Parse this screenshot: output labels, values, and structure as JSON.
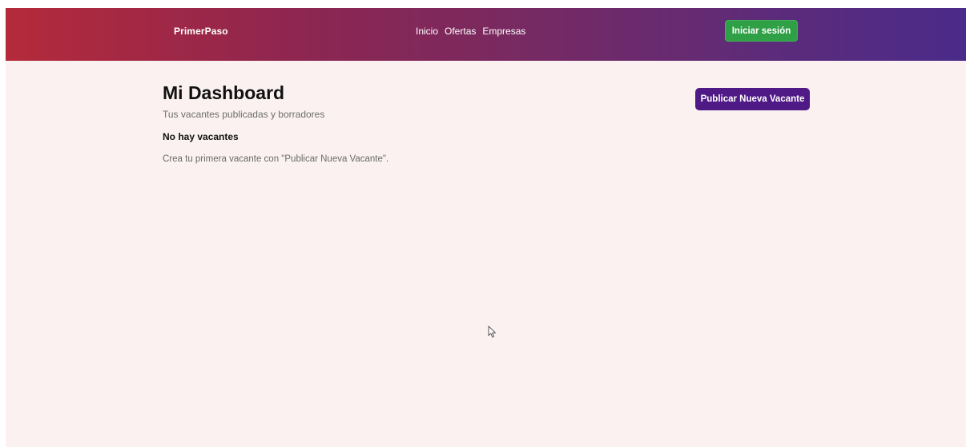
{
  "header": {
    "brand": "PrimerPaso",
    "nav": [
      "Inicio",
      "Ofertas",
      "Empresas"
    ],
    "login_label": "Iniciar sesión"
  },
  "main": {
    "title": "Mi Dashboard",
    "subtitle": "Tus vacantes publicadas y borradores",
    "publish_label": "Publicar Nueva Vacante",
    "empty_title": "No hay vacantes",
    "empty_hint": "Crea tu primera vacante con \"Publicar Nueva Vacante\"."
  },
  "icons": {
    "cursor": "mouse-pointer-icon"
  },
  "colors": {
    "header_gradient_start": "#b42a3a",
    "header_gradient_end": "#4a2b8a",
    "login_button": "#2fa046",
    "publish_button": "#4f1a85",
    "page_background": "#fbf1f1"
  }
}
